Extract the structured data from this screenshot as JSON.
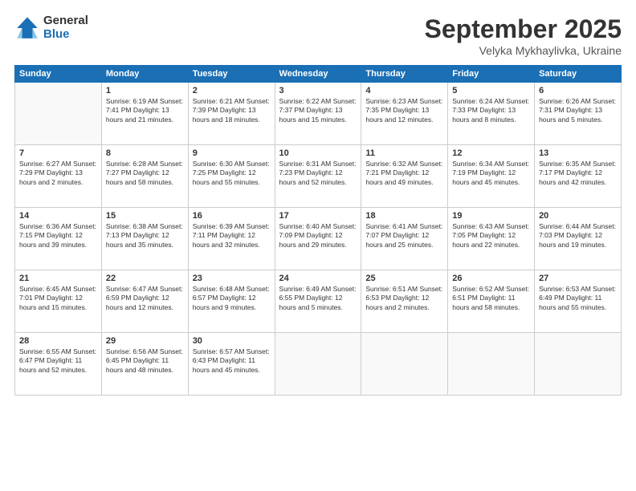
{
  "logo": {
    "general": "General",
    "blue": "Blue"
  },
  "header": {
    "month": "September 2025",
    "location": "Velyka Mykhaylivka, Ukraine"
  },
  "weekdays": [
    "Sunday",
    "Monday",
    "Tuesday",
    "Wednesday",
    "Thursday",
    "Friday",
    "Saturday"
  ],
  "weeks": [
    [
      {
        "day": "",
        "info": ""
      },
      {
        "day": "1",
        "info": "Sunrise: 6:19 AM\nSunset: 7:41 PM\nDaylight: 13 hours\nand 21 minutes."
      },
      {
        "day": "2",
        "info": "Sunrise: 6:21 AM\nSunset: 7:39 PM\nDaylight: 13 hours\nand 18 minutes."
      },
      {
        "day": "3",
        "info": "Sunrise: 6:22 AM\nSunset: 7:37 PM\nDaylight: 13 hours\nand 15 minutes."
      },
      {
        "day": "4",
        "info": "Sunrise: 6:23 AM\nSunset: 7:35 PM\nDaylight: 13 hours\nand 12 minutes."
      },
      {
        "day": "5",
        "info": "Sunrise: 6:24 AM\nSunset: 7:33 PM\nDaylight: 13 hours\nand 8 minutes."
      },
      {
        "day": "6",
        "info": "Sunrise: 6:26 AM\nSunset: 7:31 PM\nDaylight: 13 hours\nand 5 minutes."
      }
    ],
    [
      {
        "day": "7",
        "info": "Sunrise: 6:27 AM\nSunset: 7:29 PM\nDaylight: 13 hours\nand 2 minutes."
      },
      {
        "day": "8",
        "info": "Sunrise: 6:28 AM\nSunset: 7:27 PM\nDaylight: 12 hours\nand 58 minutes."
      },
      {
        "day": "9",
        "info": "Sunrise: 6:30 AM\nSunset: 7:25 PM\nDaylight: 12 hours\nand 55 minutes."
      },
      {
        "day": "10",
        "info": "Sunrise: 6:31 AM\nSunset: 7:23 PM\nDaylight: 12 hours\nand 52 minutes."
      },
      {
        "day": "11",
        "info": "Sunrise: 6:32 AM\nSunset: 7:21 PM\nDaylight: 12 hours\nand 49 minutes."
      },
      {
        "day": "12",
        "info": "Sunrise: 6:34 AM\nSunset: 7:19 PM\nDaylight: 12 hours\nand 45 minutes."
      },
      {
        "day": "13",
        "info": "Sunrise: 6:35 AM\nSunset: 7:17 PM\nDaylight: 12 hours\nand 42 minutes."
      }
    ],
    [
      {
        "day": "14",
        "info": "Sunrise: 6:36 AM\nSunset: 7:15 PM\nDaylight: 12 hours\nand 39 minutes."
      },
      {
        "day": "15",
        "info": "Sunrise: 6:38 AM\nSunset: 7:13 PM\nDaylight: 12 hours\nand 35 minutes."
      },
      {
        "day": "16",
        "info": "Sunrise: 6:39 AM\nSunset: 7:11 PM\nDaylight: 12 hours\nand 32 minutes."
      },
      {
        "day": "17",
        "info": "Sunrise: 6:40 AM\nSunset: 7:09 PM\nDaylight: 12 hours\nand 29 minutes."
      },
      {
        "day": "18",
        "info": "Sunrise: 6:41 AM\nSunset: 7:07 PM\nDaylight: 12 hours\nand 25 minutes."
      },
      {
        "day": "19",
        "info": "Sunrise: 6:43 AM\nSunset: 7:05 PM\nDaylight: 12 hours\nand 22 minutes."
      },
      {
        "day": "20",
        "info": "Sunrise: 6:44 AM\nSunset: 7:03 PM\nDaylight: 12 hours\nand 19 minutes."
      }
    ],
    [
      {
        "day": "21",
        "info": "Sunrise: 6:45 AM\nSunset: 7:01 PM\nDaylight: 12 hours\nand 15 minutes."
      },
      {
        "day": "22",
        "info": "Sunrise: 6:47 AM\nSunset: 6:59 PM\nDaylight: 12 hours\nand 12 minutes."
      },
      {
        "day": "23",
        "info": "Sunrise: 6:48 AM\nSunset: 6:57 PM\nDaylight: 12 hours\nand 9 minutes."
      },
      {
        "day": "24",
        "info": "Sunrise: 6:49 AM\nSunset: 6:55 PM\nDaylight: 12 hours\nand 5 minutes."
      },
      {
        "day": "25",
        "info": "Sunrise: 6:51 AM\nSunset: 6:53 PM\nDaylight: 12 hours\nand 2 minutes."
      },
      {
        "day": "26",
        "info": "Sunrise: 6:52 AM\nSunset: 6:51 PM\nDaylight: 11 hours\nand 58 minutes."
      },
      {
        "day": "27",
        "info": "Sunrise: 6:53 AM\nSunset: 6:49 PM\nDaylight: 11 hours\nand 55 minutes."
      }
    ],
    [
      {
        "day": "28",
        "info": "Sunrise: 6:55 AM\nSunset: 6:47 PM\nDaylight: 11 hours\nand 52 minutes."
      },
      {
        "day": "29",
        "info": "Sunrise: 6:56 AM\nSunset: 6:45 PM\nDaylight: 11 hours\nand 48 minutes."
      },
      {
        "day": "30",
        "info": "Sunrise: 6:57 AM\nSunset: 6:43 PM\nDaylight: 11 hours\nand 45 minutes."
      },
      {
        "day": "",
        "info": ""
      },
      {
        "day": "",
        "info": ""
      },
      {
        "day": "",
        "info": ""
      },
      {
        "day": "",
        "info": ""
      }
    ]
  ]
}
